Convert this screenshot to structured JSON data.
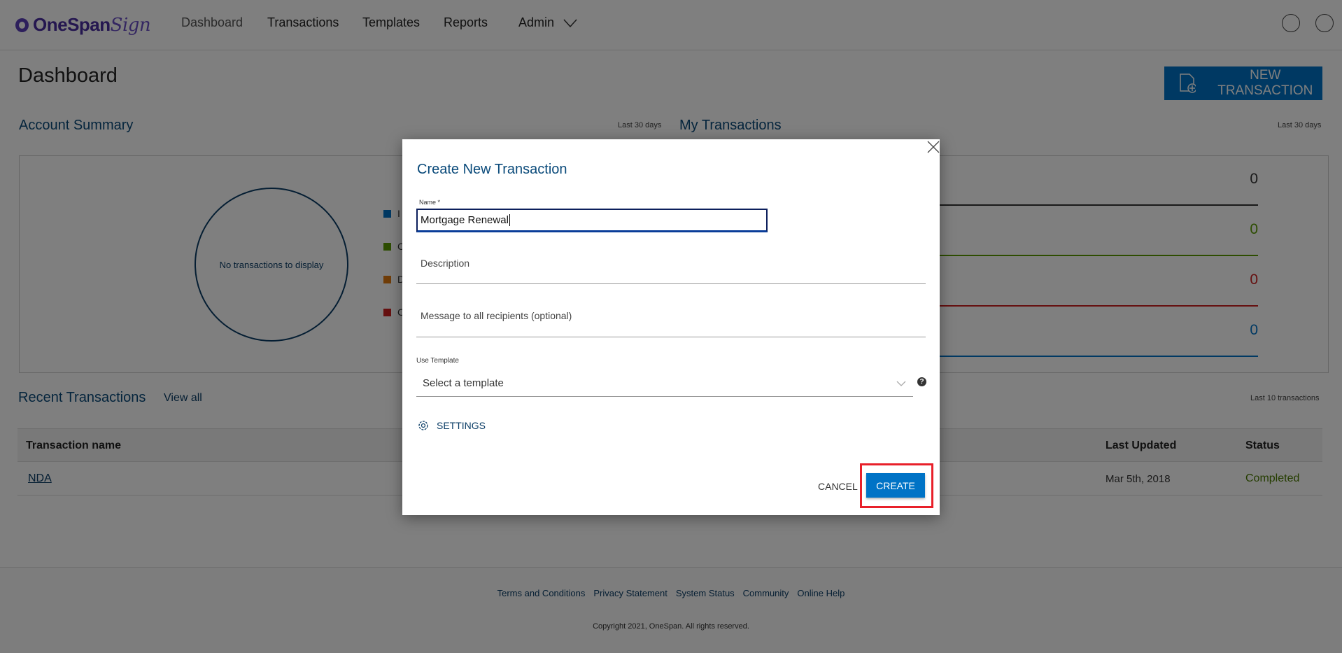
{
  "header": {
    "logo": "OneSpan",
    "logo_script": "Sign",
    "nav": [
      "Dashboard",
      "Transactions",
      "Templates",
      "Reports",
      "Admin"
    ],
    "icons": [
      "globe-icon",
      "user-icon"
    ]
  },
  "page": {
    "title": "Dashboard",
    "new_transaction": "NEW TRANSACTION"
  },
  "account_summary": {
    "title": "Account Summary",
    "period": "Last 30 days",
    "empty": "No transactions to display",
    "legend": [
      {
        "label": "I",
        "color": "#0073c6"
      },
      {
        "label": "C",
        "color": "#5a9a00"
      },
      {
        "label": "D",
        "color": "#e07a10"
      },
      {
        "label": "C",
        "color": "#cc2020"
      }
    ]
  },
  "my_transactions": {
    "title": "My Transactions",
    "period": "Last 30 days",
    "rows": [
      {
        "value": "0",
        "color": "#333333"
      },
      {
        "value": "0",
        "color": "#5a9a00"
      },
      {
        "value": "0",
        "color": "#cc2020"
      },
      {
        "value": "0",
        "color": "#0073c6"
      }
    ]
  },
  "recent": {
    "title": "Recent Transactions",
    "view_all": "View all",
    "period": "Last 10 transactions",
    "columns": [
      "Transaction name",
      "Last Updated",
      "Status"
    ],
    "rows": [
      {
        "name": "NDA",
        "updated": "Mar 5th, 2018",
        "status": "Completed"
      }
    ]
  },
  "footer": {
    "links": [
      "Terms and Conditions",
      "Privacy Statement",
      "System Status",
      "Community",
      "Online Help"
    ],
    "copyright": "Copyright 2021, OneSpan. All rights reserved."
  },
  "modal": {
    "title": "Create New Transaction",
    "name_label": "Name *",
    "name_value": "Mortgage Renewal",
    "description_placeholder": "Description",
    "message_placeholder": "Message to all recipients (optional)",
    "template_label": "Use Template",
    "template_value": "Select a template",
    "settings": "SETTINGS",
    "cancel": "CANCEL",
    "create": "CREATE",
    "highlight_color": "#e8202a"
  }
}
